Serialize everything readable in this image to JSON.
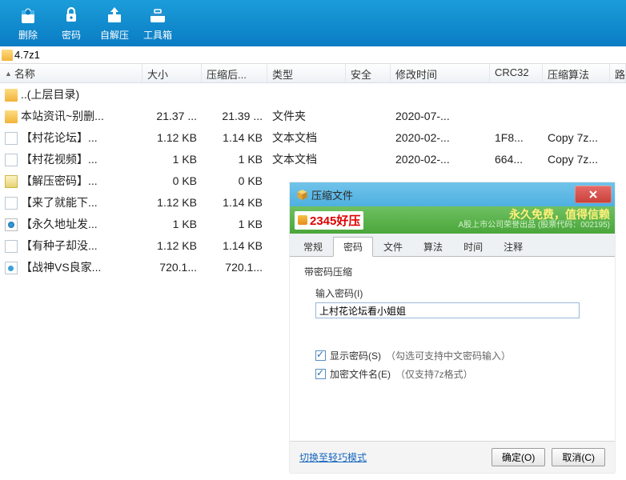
{
  "toolbar": {
    "delete": "删除",
    "password": "密码",
    "selfextract": "自解压",
    "toolbox": "工具箱"
  },
  "path": "4.7z1",
  "columns": {
    "name": "名称",
    "size": "大小",
    "compressed": "压缩后...",
    "type": "类型",
    "safe": "安全",
    "mtime": "修改时间",
    "crc": "CRC32",
    "algo": "压缩算法",
    "path": "路"
  },
  "rows": [
    {
      "icon": "folder-up",
      "name": "..(上层目录)",
      "size": "",
      "comp": "",
      "type": "",
      "safe": "",
      "mtime": "",
      "crc": "",
      "algo": ""
    },
    {
      "icon": "folder",
      "name": "本站资讯~别删...",
      "size": "21.37 ...",
      "comp": "21.39 ...",
      "type": "文件夹",
      "safe": "",
      "mtime": "2020-07-...",
      "crc": "",
      "algo": ""
    },
    {
      "icon": "txt",
      "name": "【村花论坛】...",
      "size": "1.12 KB",
      "comp": "1.14 KB",
      "type": "文本文档",
      "safe": "",
      "mtime": "2020-02-...",
      "crc": "1F8...",
      "algo": "Copy 7z..."
    },
    {
      "icon": "txt",
      "name": "【村花视频】...",
      "size": "1 KB",
      "comp": "1 KB",
      "type": "文本文档",
      "safe": "",
      "mtime": "2020-02-...",
      "crc": "664...",
      "algo": "Copy 7z..."
    },
    {
      "icon": "bat",
      "name": "【解压密码】...",
      "size": "0 KB",
      "comp": "0 KB",
      "type": "",
      "safe": "",
      "mtime": "",
      "crc": "",
      "algo": ""
    },
    {
      "icon": "txt",
      "name": "【来了就能下...",
      "size": "1.12 KB",
      "comp": "1.14 KB",
      "type": "",
      "safe": "",
      "mtime": "",
      "crc": "",
      "algo": ""
    },
    {
      "icon": "html",
      "name": "【永久地址发...",
      "size": "1 KB",
      "comp": "1 KB",
      "type": "",
      "safe": "",
      "mtime": "",
      "crc": "",
      "algo": ""
    },
    {
      "icon": "txt",
      "name": "【有种子却没...",
      "size": "1.12 KB",
      "comp": "1.14 KB",
      "type": "",
      "safe": "",
      "mtime": "",
      "crc": "",
      "algo": ""
    },
    {
      "icon": "url",
      "name": "【战神VS良家...",
      "size": "720.1...",
      "comp": "720.1...",
      "type": "",
      "safe": "",
      "mtime": "",
      "crc": "",
      "algo": ""
    }
  ],
  "dialog": {
    "title": "压缩文件",
    "brand": "2345好压",
    "slogan1": "永久免费，值得信赖",
    "slogan2": "A股上市公司荣誉出品 (股票代码：002195)",
    "tabs": [
      "常规",
      "密码",
      "文件",
      "算法",
      "时间",
      "注释"
    ],
    "active_tab": 1,
    "group_title": "带密码压缩",
    "pwd_label": "输入密码(I)",
    "pwd_value": "上村花论坛看小姐姐",
    "show_pwd_label": "显示密码(S)",
    "show_pwd_hint": "（勾选可支持中文密码输入）",
    "encrypt_fn_label": "加密文件名(E)",
    "encrypt_fn_hint": "（仅支持7z格式）",
    "switch_mode": "切换至轻巧模式",
    "ok": "确定(O)",
    "cancel": "取消(C)"
  }
}
